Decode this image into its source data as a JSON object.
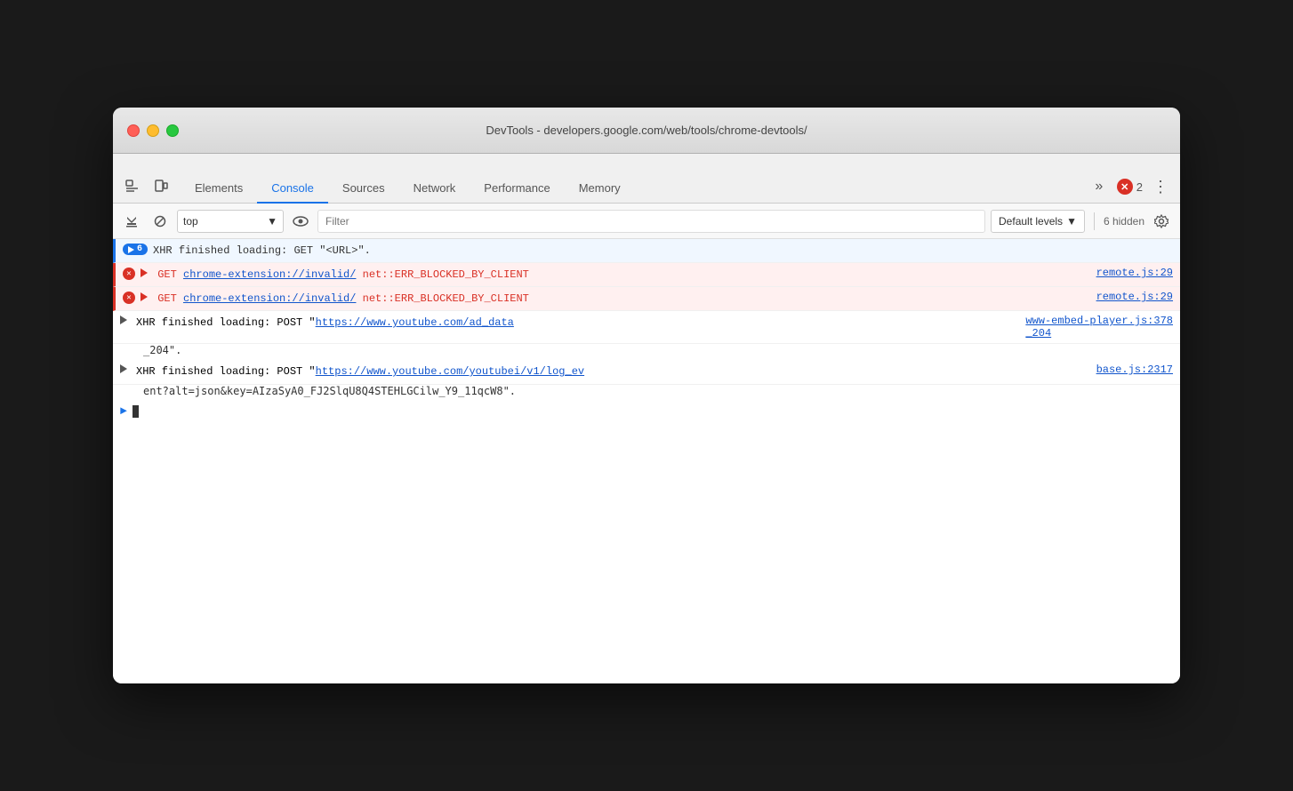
{
  "window": {
    "title": "DevTools - developers.google.com/web/tools/chrome-devtools/"
  },
  "titleBar": {
    "close": "close",
    "minimize": "minimize",
    "maximize": "maximize"
  },
  "tabs": [
    {
      "id": "elements",
      "label": "Elements",
      "active": false
    },
    {
      "id": "console",
      "label": "Console",
      "active": true
    },
    {
      "id": "sources",
      "label": "Sources",
      "active": false
    },
    {
      "id": "network",
      "label": "Network",
      "active": false
    },
    {
      "id": "performance",
      "label": "Performance",
      "active": false
    },
    {
      "id": "memory",
      "label": "Memory",
      "active": false
    }
  ],
  "errorBadge": {
    "count": "2"
  },
  "toolbar": {
    "context": "top",
    "filterPlaceholder": "Filter",
    "levels": "Default levels",
    "hiddenCount": "6 hidden"
  },
  "consoleEntries": [
    {
      "type": "info-group",
      "badgeNumber": "6",
      "text": "XHR finished loading: GET \"<URL>\".",
      "source": ""
    },
    {
      "type": "error",
      "method": "GET",
      "url": "chrome-extension://invalid/",
      "error": "net::ERR_BLOCKED_BY_CLIENT",
      "source": "remote.js:29"
    },
    {
      "type": "error",
      "method": "GET",
      "url": "chrome-extension://invalid/",
      "error": "net::ERR_BLOCKED_BY_CLIENT",
      "source": "remote.js:29"
    },
    {
      "type": "normal",
      "text": "XHR finished loading: POST \"",
      "url": "https://www.youtube.com/ad_data",
      "textAfter": "\".",
      "source": "www-embed-player.js:378\n_204"
    },
    {
      "type": "normal",
      "text": "XHR finished loading: POST \"",
      "url": "https://www.youtube.com/youtubei/v1/log_ev",
      "textAfter": "ent?alt=json&key=AIzaSyA0_FJ2SlqU8Q4STEHLGCilw_Y9_11qcW8\".",
      "source": "base.js:2317\nent?alt=json&key=AIzaSyA0_FJ2SlqU8Q4STEHLGCilw_Y9_11qcW8"
    }
  ]
}
